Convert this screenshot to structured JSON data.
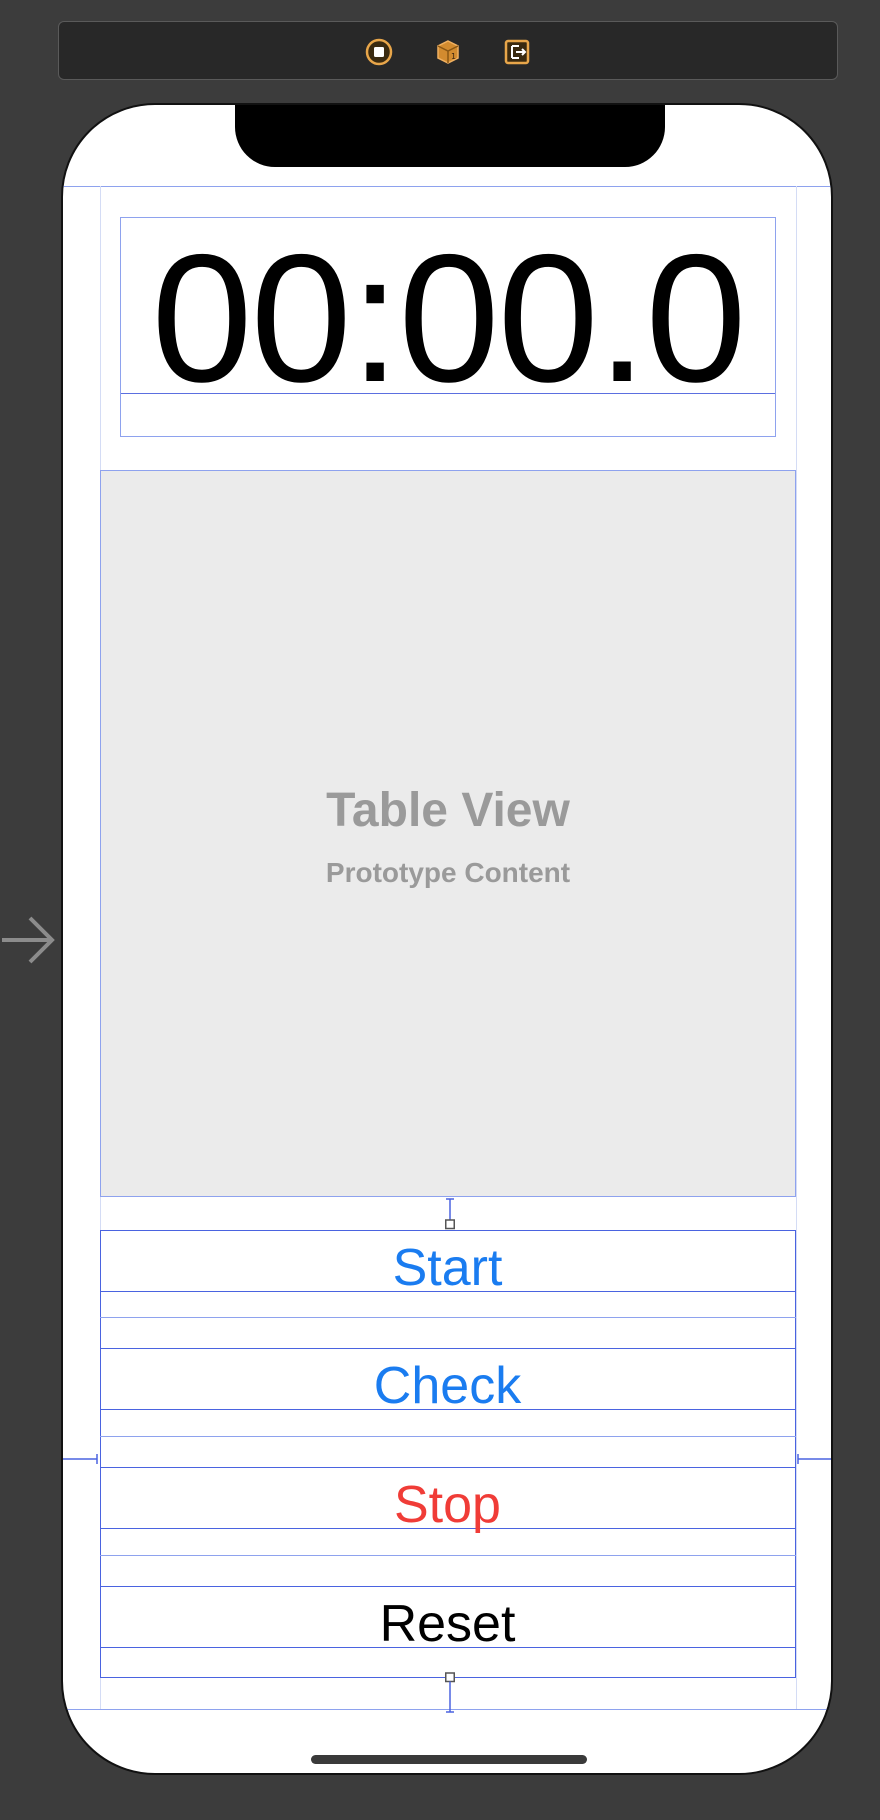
{
  "toolbar": {
    "icons": [
      "view-controller-icon",
      "first-responder-icon",
      "exit-icon"
    ]
  },
  "timer": {
    "label": "00:00.0"
  },
  "table_view": {
    "title": "Table View",
    "subtitle": "Prototype Content"
  },
  "buttons": {
    "start": "Start",
    "check": "Check",
    "stop": "Stop",
    "reset": "Reset"
  },
  "colors": {
    "start": "#1a7cf0",
    "check": "#1a7cf0",
    "stop": "#f03c37",
    "reset": "#000000",
    "toolbar_icon": "#e8a64a",
    "constraint": "#4a63e0"
  }
}
